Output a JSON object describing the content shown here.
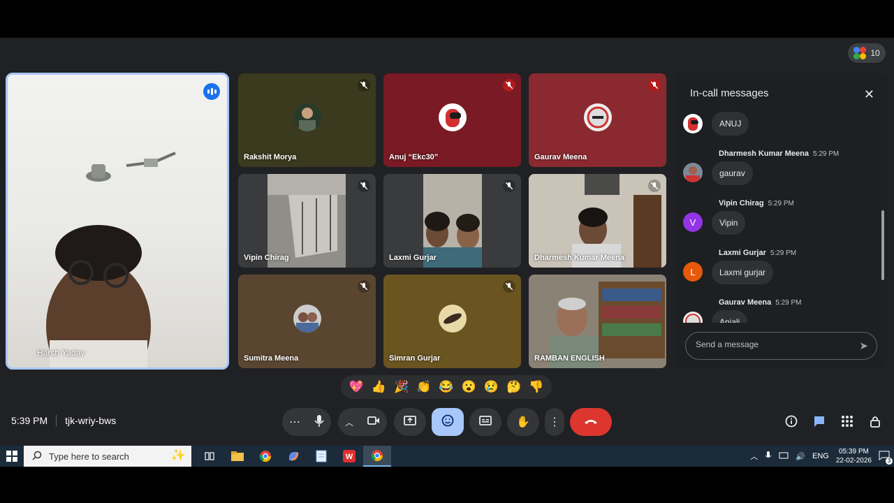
{
  "meet": {
    "participant_count": "10",
    "main_tile": {
      "name": "Harsh Yadav",
      "speaking": true
    },
    "tiles": [
      {
        "name": "Rakshit Morya",
        "muted": true
      },
      {
        "name": "Anuj “Ekc30”",
        "muted": true
      },
      {
        "name": "Gaurav Meena",
        "muted": true
      },
      {
        "name": "Vipin Chirag",
        "muted": true
      },
      {
        "name": "Laxmi Gurjar",
        "muted": true
      },
      {
        "name": "Dharmesh Kumar Meena",
        "muted": true
      },
      {
        "name": "Sumitra Meena",
        "muted": true
      },
      {
        "name": "Simran Gurjar",
        "muted": true
      },
      {
        "name": "RAMBAN ENGLISH",
        "muted": false
      }
    ],
    "chat": {
      "title": "In-call messages",
      "messages": [
        {
          "sender": "",
          "time": "",
          "text": "ANUJ",
          "avatar": "among-us-avatar"
        },
        {
          "sender": "Dharmesh Kumar Meena",
          "time": "5:29 PM",
          "text": "gaurav",
          "avatar": "photo-avatar"
        },
        {
          "sender": "Vipin Chirag",
          "time": "5:29 PM",
          "text": "Vipin",
          "avatar_letter": "V",
          "avatar_color": "#9334e6"
        },
        {
          "sender": "Laxmi Gurjar",
          "time": "5:29 PM",
          "text": "Laxmi gurjar",
          "avatar_letter": "L",
          "avatar_color": "#e8590c"
        },
        {
          "sender": "Gaurav Meena",
          "time": "5:29 PM",
          "text": "Anjali",
          "avatar": "photo-avatar"
        }
      ],
      "input_placeholder": "Send a message"
    },
    "reactions": [
      "💖",
      "👍",
      "🎉",
      "👏",
      "😂",
      "😮",
      "😢",
      "🤔",
      "👎"
    ],
    "time": "5:39 PM",
    "meeting_code": "tjk-wriy-bws"
  },
  "taskbar": {
    "search_placeholder": "Type here to search",
    "language": "ENG",
    "clock_time": "05:39 PM",
    "clock_date": "22-02-2026",
    "notifications": "3"
  }
}
